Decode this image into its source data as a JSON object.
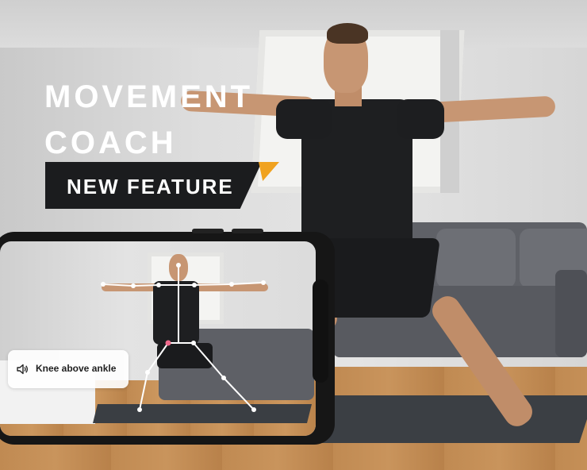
{
  "hero": {
    "title_line1": "MOVEMENT",
    "title_line2": "COACH",
    "badge": "NEW FEATURE"
  },
  "feedback": {
    "icon": "speaker-icon",
    "message": "Knee above ankle"
  },
  "colors": {
    "badge_bg": "#1b1c1e",
    "badge_accent": "#f0a21f",
    "title_text": "#ffffff",
    "skeleton_line": "#ffffff",
    "skeleton_joint_highlight": "#f06a8c"
  }
}
